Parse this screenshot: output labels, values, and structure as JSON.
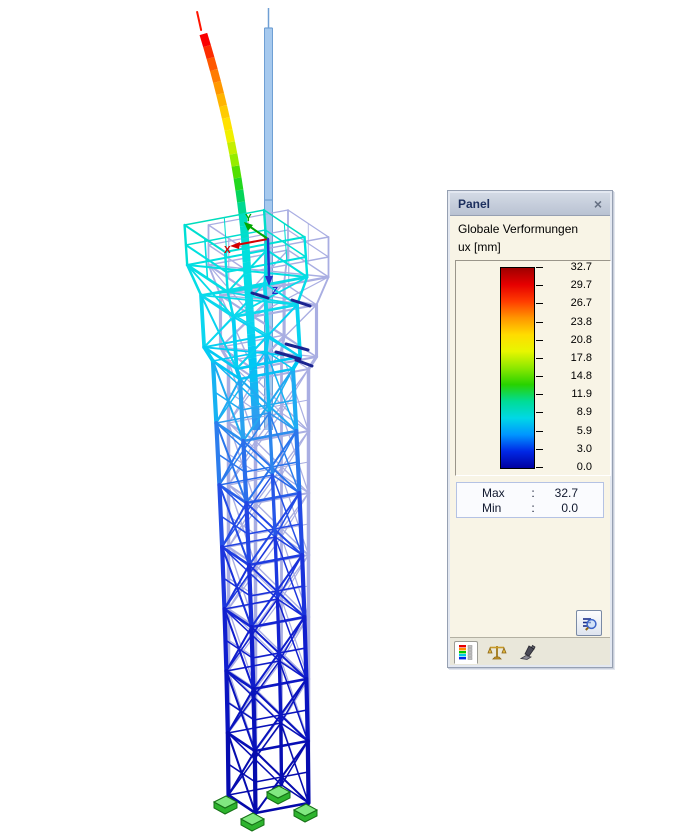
{
  "panel": {
    "title": "Panel",
    "close_glyph": "×",
    "subtitle": "Globale Verformungen",
    "unit_label": "ux [mm]",
    "legend": {
      "values": [
        "32.7",
        "29.7",
        "26.7",
        "23.8",
        "20.8",
        "17.8",
        "14.8",
        "11.9",
        "8.9",
        "5.9",
        "3.0",
        "0.0"
      ],
      "gradient_stops": [
        "#A00000",
        "#E60000",
        "#FF3C00",
        "#FF9600",
        "#FFDC00",
        "#E8F600",
        "#8CE800",
        "#28D200",
        "#00DC96",
        "#00D8E6",
        "#0096FF",
        "#0028E6",
        "#0000A0"
      ]
    },
    "stats": {
      "max_label": "Max",
      "max_colon": ":",
      "max_value": "32.7",
      "min_label": "Min",
      "min_colon": ":",
      "min_value": "0.0"
    },
    "tabs": [
      {
        "icon": "color-spectrum-icon",
        "active": true
      },
      {
        "icon": "factors-balance-icon",
        "active": false
      },
      {
        "icon": "filter-stamp-icon",
        "active": false
      }
    ]
  },
  "axes": {
    "x": "X",
    "y": "Y",
    "z": "Z",
    "x_color": "#D40000",
    "y_color": "#00A800",
    "z_color": "#2430C8"
  },
  "scene": {
    "background": "#FFFFFF",
    "undeformed_color": "#A9AEE2",
    "undeformed_back_color": "#B9BDEA",
    "undeformed_antenna_fill": "#A6C9EE",
    "undeformed_antenna_edge": "#6F9FD4",
    "antenna_tip_color": "#FF1400",
    "support_side_color": "#2EB42E",
    "support_top_color": "#80E880",
    "support_edge_color": "#157015",
    "accent_navy_members": "#1B2490",
    "deformation_stops": [
      [
        12,
        "#C00000"
      ],
      [
        40,
        "#FA0000"
      ],
      [
        70,
        "#FF6E00"
      ],
      [
        100,
        "#FFB400"
      ],
      [
        132,
        "#FFF000"
      ],
      [
        158,
        "#A0EE00"
      ],
      [
        178,
        "#30D800"
      ],
      [
        198,
        "#00D464"
      ],
      [
        218,
        "#00DCBE"
      ],
      [
        255,
        "#00E0DE"
      ],
      [
        315,
        "#0CD8EE"
      ],
      [
        368,
        "#00C6F5"
      ],
      [
        415,
        "#2E9EF0"
      ],
      [
        465,
        "#2B74EC"
      ],
      [
        520,
        "#244CE6"
      ],
      [
        575,
        "#1C36DE"
      ],
      [
        635,
        "#1220D0"
      ],
      [
        700,
        "#0A14C0"
      ],
      [
        765,
        "#060CB0"
      ],
      [
        830,
        "#0408A6"
      ]
    ]
  }
}
